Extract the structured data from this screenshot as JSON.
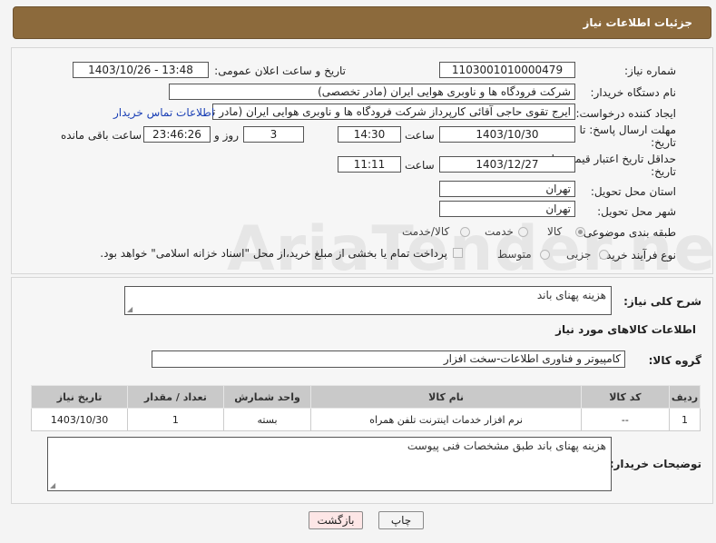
{
  "header": {
    "title": "جزئیات اطلاعات نیاز"
  },
  "form": {
    "need_number_label": "شماره نیاز:",
    "need_number": "1103001010000479",
    "announce_label": "تاریخ و ساعت اعلان عمومی:",
    "announce_value": "1403/10/26 - 13:48",
    "buyer_org_label": "نام دستگاه خریدار:",
    "buyer_org": "شرکت فرودگاه ها و ناوبری هوایی ایران (مادر تخصصی)",
    "creator_label": "ایجاد کننده درخواست:",
    "creator": "ایرج تقوی حاجی آقائی کارپرداز شرکت فرودگاه ها و ناوبری هوایی ایران (مادر تخصصی)",
    "contact_link": "اطلاعات تماس خریدار",
    "deadline_label_1": "مهلت ارسال پاسخ: تا",
    "deadline_label_2": "تاریخ:",
    "deadline_date": "1403/10/30",
    "time_label": "ساعت",
    "deadline_time": "14:30",
    "days_value": "3",
    "days_label": "روز و",
    "remaining_time": "23:46:26",
    "remaining_label": "ساعت باقی مانده",
    "price_validity_label_1": "حداقل تاریخ اعتبار قیمت: تا",
    "price_validity_label_2": "تاریخ:",
    "price_validity_date": "1403/12/27",
    "price_validity_time": "11:11",
    "province_label": "استان محل تحویل:",
    "province": "تهران",
    "city_label": "شهر محل تحویل:",
    "city": "تهران",
    "category_label": "طبقه بندی موضوعی:",
    "category_options": [
      "کالا",
      "خدمت",
      "کالا/خدمت"
    ],
    "category_selected": "کالا",
    "purchase_type_label": "نوع فرآیند خرید :",
    "purchase_options": [
      "جزیی",
      "متوسط"
    ],
    "payment_note": "پرداخت تمام یا بخشی از مبلغ خرید،از محل \"اسناد خزانه اسلامی\" خواهد بود."
  },
  "details": {
    "description_label": "شرح کلی نیاز:",
    "description": "هزینه پهنای باند",
    "goods_info_title": "اطلاعات کالاهای مورد نیاز",
    "goods_group_label": "گروه کالا:",
    "goods_group": "کامپیوتر و فناوری اطلاعات-سخت افزار",
    "table": {
      "headers": [
        "ردیف",
        "کد کالا",
        "نام کالا",
        "واحد شمارش",
        "تعداد / مقدار",
        "تاریخ نیاز"
      ],
      "rows": [
        [
          "1",
          "--",
          "نرم افزار خدمات اینترنت تلفن همراه",
          "بسته",
          "1",
          "1403/10/30"
        ]
      ]
    },
    "buyer_notes_label": "توضیحات خریدار:",
    "buyer_notes": "هزینه پهنای باند  طبق مشخصات فنی پیوست"
  },
  "buttons": {
    "print": "چاپ",
    "back": "بازگشت"
  },
  "watermark": "AriaTender.neT"
}
